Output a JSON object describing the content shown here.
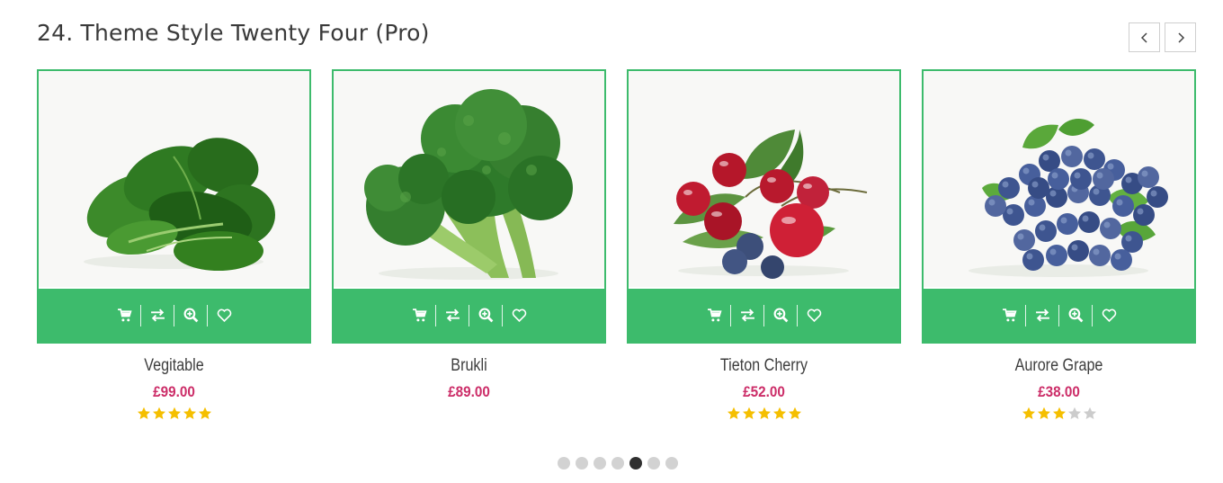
{
  "section": {
    "title": "24. Theme Style Twenty Four (Pro)"
  },
  "carousel": {
    "prev_icon": "chevron-left-icon",
    "next_icon": "chevron-right-icon",
    "dot_count": 7,
    "active_dot": 5
  },
  "colors": {
    "accent": "#3dbb6c",
    "price": "#cc2d68",
    "star_filled": "#f5bf00",
    "star_empty": "#cccccc"
  },
  "actions": [
    {
      "name": "add-to-cart",
      "icon": "cart-icon"
    },
    {
      "name": "compare",
      "icon": "compare-icon"
    },
    {
      "name": "quick-view",
      "icon": "zoom-icon"
    },
    {
      "name": "wishlist",
      "icon": "heart-icon"
    }
  ],
  "products": [
    {
      "name": "Vegitable",
      "price": "£99.00",
      "rating": 5,
      "image": "spinach"
    },
    {
      "name": "Brukli",
      "price": "£89.00",
      "rating": 0,
      "image": "broccoli"
    },
    {
      "name": "Tieton Cherry",
      "price": "£52.00",
      "rating": 5,
      "image": "cherries"
    },
    {
      "name": "Aurore Grape",
      "price": "£38.00",
      "rating": 3,
      "image": "blueberries"
    }
  ]
}
